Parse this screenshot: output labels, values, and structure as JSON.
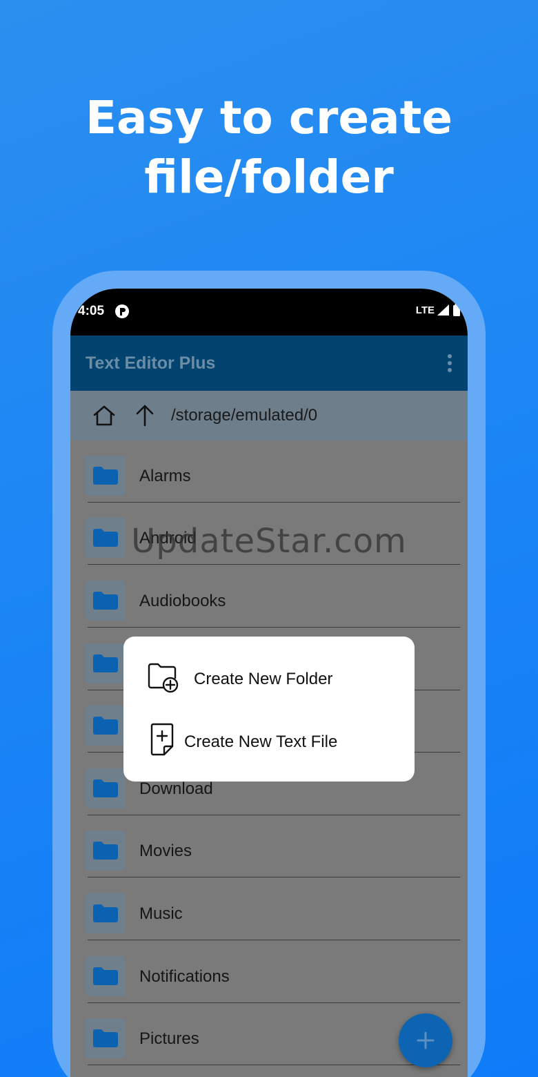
{
  "promo": {
    "headline_line1": "Easy to create",
    "headline_line2": "file/folder"
  },
  "status_bar": {
    "time": "4:05",
    "network": "LTE"
  },
  "app_bar": {
    "title": "Text Editor Plus"
  },
  "path_bar": {
    "path": "/storage/emulated/0"
  },
  "folders": [
    "Alarms",
    "Android",
    "Audiobooks",
    "",
    "",
    "Download",
    "Movies",
    "Music",
    "Notifications",
    "Pictures"
  ],
  "dialog": {
    "create_folder": "Create New Folder",
    "create_text_file": "Create New Text File"
  },
  "watermark": "UpdateStar.com",
  "colors": {
    "background": "#1c86f5",
    "app_bar": "#034370",
    "folder_icon": "#0a62b0",
    "fab": "#0c64b3"
  }
}
